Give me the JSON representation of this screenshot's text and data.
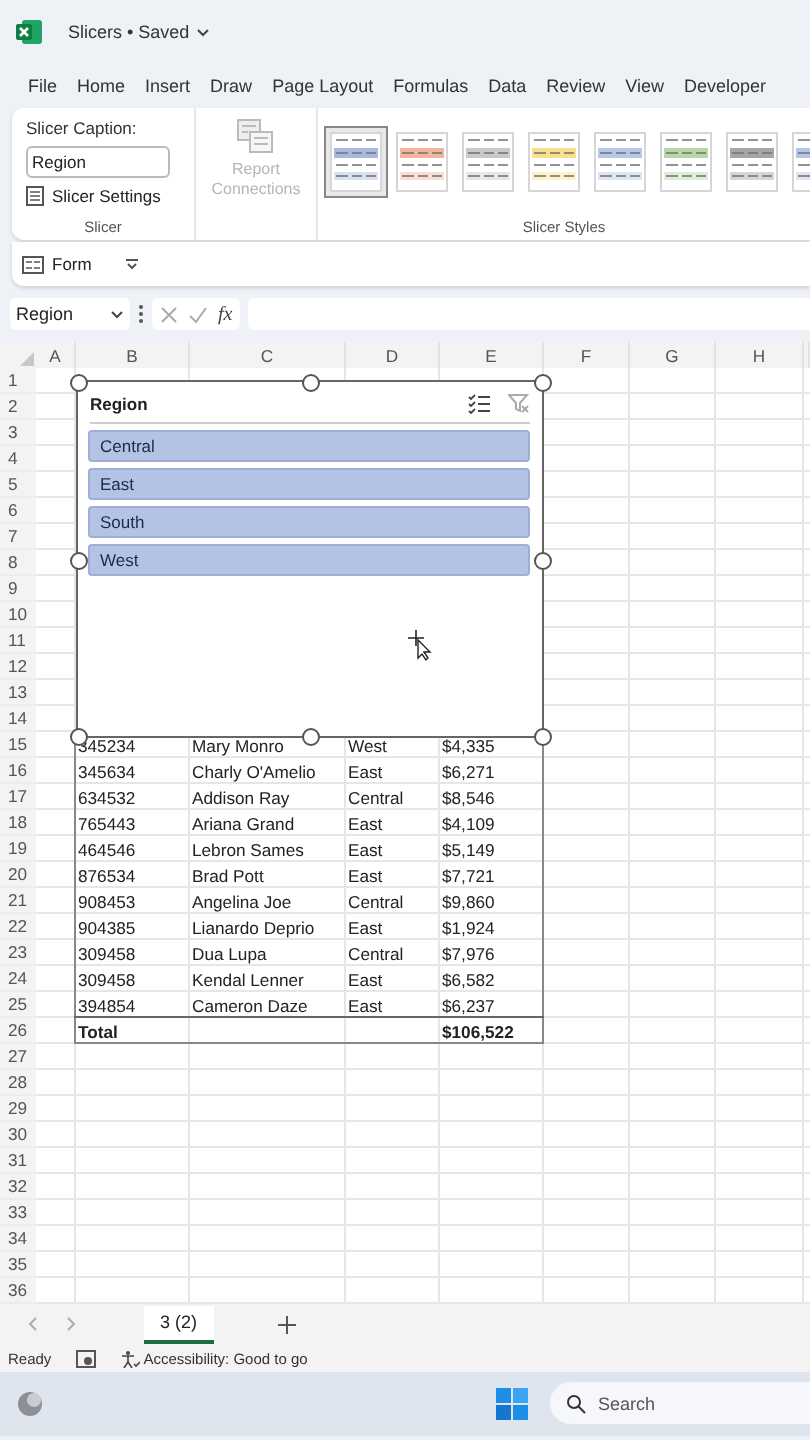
{
  "window": {
    "title": "Slicers • Saved"
  },
  "ribbon_tabs": [
    "File",
    "Home",
    "Insert",
    "Draw",
    "Page Layout",
    "Formulas",
    "Data",
    "Review",
    "View",
    "Developer"
  ],
  "ribbon": {
    "caption_label": "Slicer Caption:",
    "caption_value": "Region",
    "slicer_settings": "Slicer Settings",
    "report_connections": {
      "label": "Report Connections",
      "disabled": true
    },
    "group_slicer": "Slicer",
    "group_styles": "Slicer Styles",
    "styles": [
      {
        "color": "#a9b8de",
        "selected": true
      },
      {
        "color": "#f2b49a",
        "selected": false
      },
      {
        "color": "#c9c9c9",
        "selected": false
      },
      {
        "color": "#fbe08c",
        "selected": false
      },
      {
        "color": "#b3c9e6",
        "selected": false
      },
      {
        "color": "#b7d8a6",
        "selected": false
      },
      {
        "color": "#a5a5a5",
        "selected": false
      },
      {
        "color": "#b4c6e7",
        "selected": false
      }
    ]
  },
  "quick_access": {
    "form": "Form"
  },
  "formula_bar": {
    "name_box": "Region",
    "fx": "fx"
  },
  "columns": [
    "A",
    "B",
    "C",
    "D",
    "E",
    "F",
    "G",
    "H"
  ],
  "row_numbers": [
    "1",
    "2",
    "3",
    "4",
    "5",
    "6",
    "7",
    "8",
    "9",
    "10",
    "11",
    "12",
    "13",
    "14",
    "15",
    "16",
    "17",
    "18",
    "19",
    "20",
    "21",
    "22",
    "23",
    "24",
    "25",
    "26",
    "27",
    "28",
    "29",
    "30",
    "31",
    "32",
    "33",
    "34",
    "35",
    "36"
  ],
  "table": {
    "rows": [
      {
        "id": "345234",
        "name": "Mary Monro",
        "region": "West",
        "amount": "$4,335"
      },
      {
        "id": "345634",
        "name": "Charly O'Amelio",
        "region": "East",
        "amount": "$6,271"
      },
      {
        "id": "634532",
        "name": "Addison Ray",
        "region": "Central",
        "amount": "$8,546"
      },
      {
        "id": "765443",
        "name": "Ariana Grand",
        "region": "East",
        "amount": "$4,109"
      },
      {
        "id": "464546",
        "name": "Lebron Sames",
        "region": "East",
        "amount": "$5,149"
      },
      {
        "id": "876534",
        "name": "Brad Pott",
        "region": "East",
        "amount": "$7,721"
      },
      {
        "id": "908453",
        "name": "Angelina Joe",
        "region": "Central",
        "amount": "$9,860"
      },
      {
        "id": "904385",
        "name": "Lianardo Deprio",
        "region": "East",
        "amount": "$1,924"
      },
      {
        "id": "309458",
        "name": "Dua Lupa",
        "region": "Central",
        "amount": "$7,976"
      },
      {
        "id": "309458",
        "name": "Kendal Lenner",
        "region": "East",
        "amount": "$6,582"
      },
      {
        "id": "394854",
        "name": "Cameron Daze",
        "region": "East",
        "amount": "$6,237"
      }
    ],
    "total": {
      "label": "Total",
      "amount": "$106,522"
    }
  },
  "slicer": {
    "title": "Region",
    "items": [
      {
        "label": "Central",
        "selected": true
      },
      {
        "label": "East",
        "selected": true
      },
      {
        "label": "South",
        "selected": true
      },
      {
        "label": "West",
        "selected": true
      }
    ]
  },
  "sheet_tabs": [
    {
      "label": "3 (2)",
      "selected": true
    }
  ],
  "status_bar": {
    "ready": "Ready",
    "accessibility": "Accessibility: Good to go"
  },
  "taskbar": {
    "search_placeholder": "Search"
  }
}
